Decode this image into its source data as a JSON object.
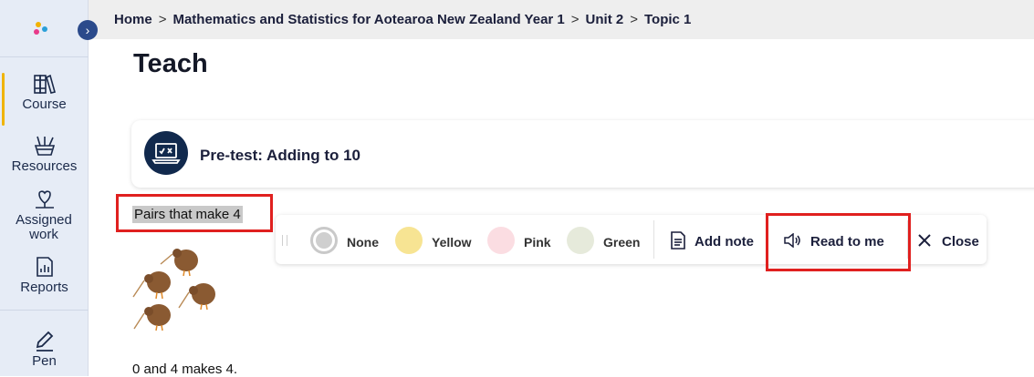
{
  "sidebar": {
    "logo": "app-logo",
    "expand_icon": "›",
    "items": [
      {
        "label": "Course",
        "icon": "books-icon"
      },
      {
        "label": "Resources",
        "icon": "resources-icon"
      },
      {
        "label": "Assigned work",
        "icon": "assigned-work-icon"
      },
      {
        "label": "Reports",
        "icon": "reports-icon"
      },
      {
        "label": "Pen",
        "icon": "pen-icon"
      }
    ]
  },
  "breadcrumb": {
    "items": [
      "Home",
      "Mathematics and Statistics for Aotearoa New Zealand Year 1",
      "Unit 2",
      "Topic 1"
    ],
    "separator": ">"
  },
  "page": {
    "title": "Teach",
    "card_title": "Pre-test: Adding to 10",
    "highlighted_text": "Pairs that make 4",
    "body_text": "0 and 4 makes 4."
  },
  "toolbar": {
    "colors": [
      {
        "label": "None",
        "color": "#ffffff"
      },
      {
        "label": "Yellow",
        "color": "#f7e493"
      },
      {
        "label": "Pink",
        "color": "#fbdde2"
      },
      {
        "label": "Green",
        "color": "#e6eadb"
      }
    ],
    "add_note": "Add note",
    "read_to_me": "Read to me",
    "close": "Close"
  },
  "colors": {
    "accent_active": "#f0b400",
    "annotation_red": "#e0201f",
    "dark_navy": "#11294d"
  }
}
